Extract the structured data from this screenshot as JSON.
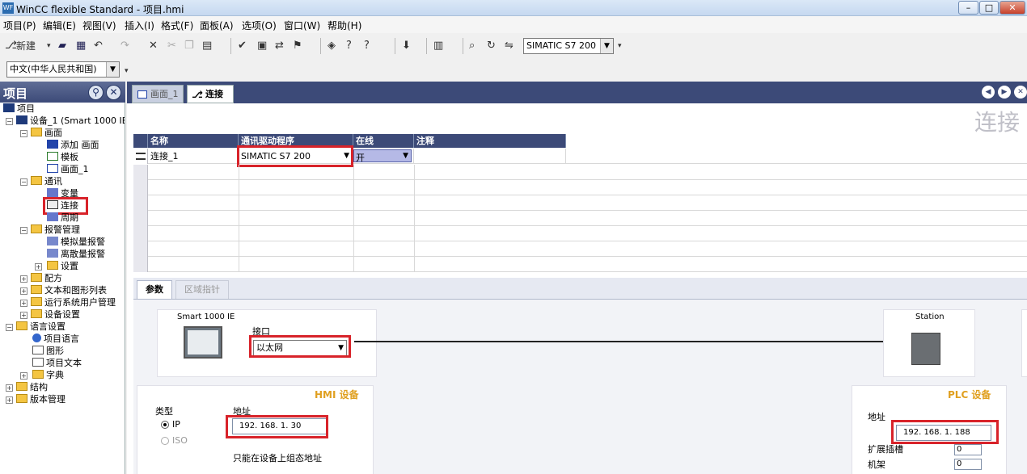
{
  "window": {
    "title": "WinCC flexible Standard - 项目.hmi",
    "icon_text": "WF"
  },
  "menu": [
    "项目(P)",
    "编辑(E)",
    "视图(V)",
    "插入(I)",
    "格式(F)",
    "面板(A)",
    "选项(O)",
    "窗口(W)",
    "帮助(H)"
  ],
  "toolbar": {
    "new_label": "新建",
    "device_combo": "SIMATIC S7 200",
    "language_combo": "中文(中华人民共和国)"
  },
  "project": {
    "header": "项目",
    "tree": {
      "root": "项目",
      "device": "设备_1 (Smart 1000 IE",
      "screens": "画面",
      "add_screen": "添加 画面",
      "template": "模板",
      "screen1": "画面_1",
      "comm": "通讯",
      "tags": "变量",
      "connections": "连接",
      "cycles": "周期",
      "alarms": "报警管理",
      "analog_alarms": "模拟量报警",
      "discrete_alarms": "离散量报警",
      "alarm_settings": "设置",
      "recipes": "配方",
      "text_lists": "文本和图形列表",
      "runtime_users": "运行系统用户管理",
      "device_settings": "设备设置",
      "lang_settings": "语言设置",
      "project_lang": "项目语言",
      "graphics": "图形",
      "project_texts": "项目文本",
      "dictionary": "字典",
      "structure": "结构",
      "versions": "版本管理"
    }
  },
  "tabs": {
    "screen": "画面_1",
    "connection": "连接"
  },
  "page_title": "连接",
  "grid": {
    "headers": [
      "名称",
      "通讯驱动程序",
      "在线",
      "注释"
    ],
    "rows": [
      {
        "name": "连接_1",
        "driver": "SIMATIC S7 200",
        "online": "开",
        "comment": ""
      }
    ]
  },
  "properties": {
    "tabs": [
      "参数",
      "区域指针"
    ],
    "hmi_device_name": "Smart 1000 IE",
    "interface_label": "接口",
    "interface_value": "以太网",
    "station_label": "Station",
    "hmi_section": "HMI 设备",
    "plc_section": "PLC 设备",
    "type_label": "类型",
    "type_ip": "IP",
    "type_iso": "ISO",
    "address_label": "地址",
    "hmi_address": "192. 168. 1. 30",
    "hmi_note": "只能在设备上组态地址",
    "plc_address_label": "地址",
    "plc_address": "192. 168. 1. 188",
    "expansion_slot": "扩展插槽",
    "rack": "机架",
    "slot_value": "0",
    "rack_value": "0"
  }
}
